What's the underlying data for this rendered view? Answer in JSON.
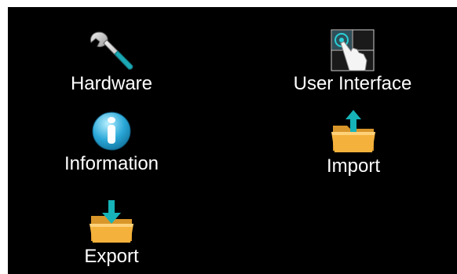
{
  "menu": {
    "items": [
      {
        "label": "Hardware",
        "icon": "wrench-icon"
      },
      {
        "label": "User Interface",
        "icon": "touch-grid-icon"
      },
      {
        "label": "Information",
        "icon": "info-icon"
      },
      {
        "label": "Import",
        "icon": "folder-import-icon"
      },
      {
        "label": "Export",
        "icon": "folder-export-icon"
      }
    ]
  },
  "colors": {
    "background": "#000000",
    "text": "#ffffff",
    "folder": "#f4b23c",
    "arrow": "#16b3b8",
    "info_blue": "#2aa8d8"
  }
}
